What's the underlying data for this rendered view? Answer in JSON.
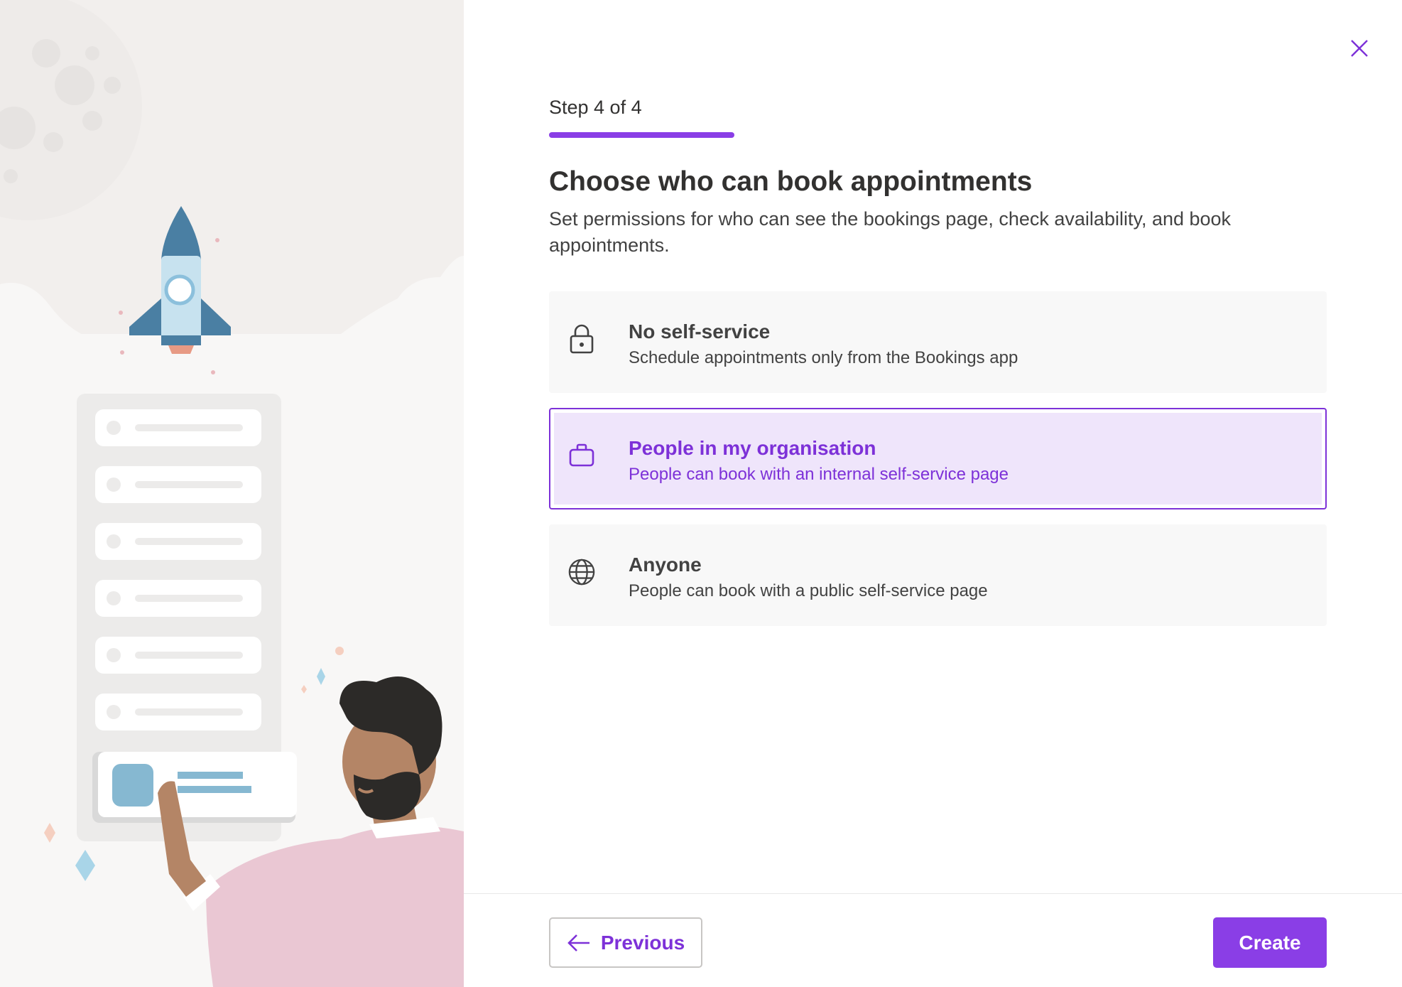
{
  "wizard": {
    "step_label": "Step 4 of 4",
    "progress": 1.0,
    "title": "Choose who can book appointments",
    "description": "Set permissions for who can see the bookings page, check availability, and book appointments."
  },
  "options": [
    {
      "title": "No self-service",
      "description": "Schedule appointments only from the Bookings app",
      "icon": "lock-icon",
      "selected": false
    },
    {
      "title": "People in my organisation",
      "description": "People can book with an internal self-service page",
      "icon": "briefcase-icon",
      "selected": true
    },
    {
      "title": "Anyone",
      "description": "People can book with a public self-service page",
      "icon": "globe-icon",
      "selected": false
    }
  ],
  "footer": {
    "previous_label": "Previous",
    "create_label": "Create"
  },
  "colors": {
    "accent": "#8a3ee6",
    "accent_text": "#7d31d8",
    "selected_background": "#efe5fb",
    "option_background": "#f8f8f8"
  },
  "close_icon": "close-icon"
}
